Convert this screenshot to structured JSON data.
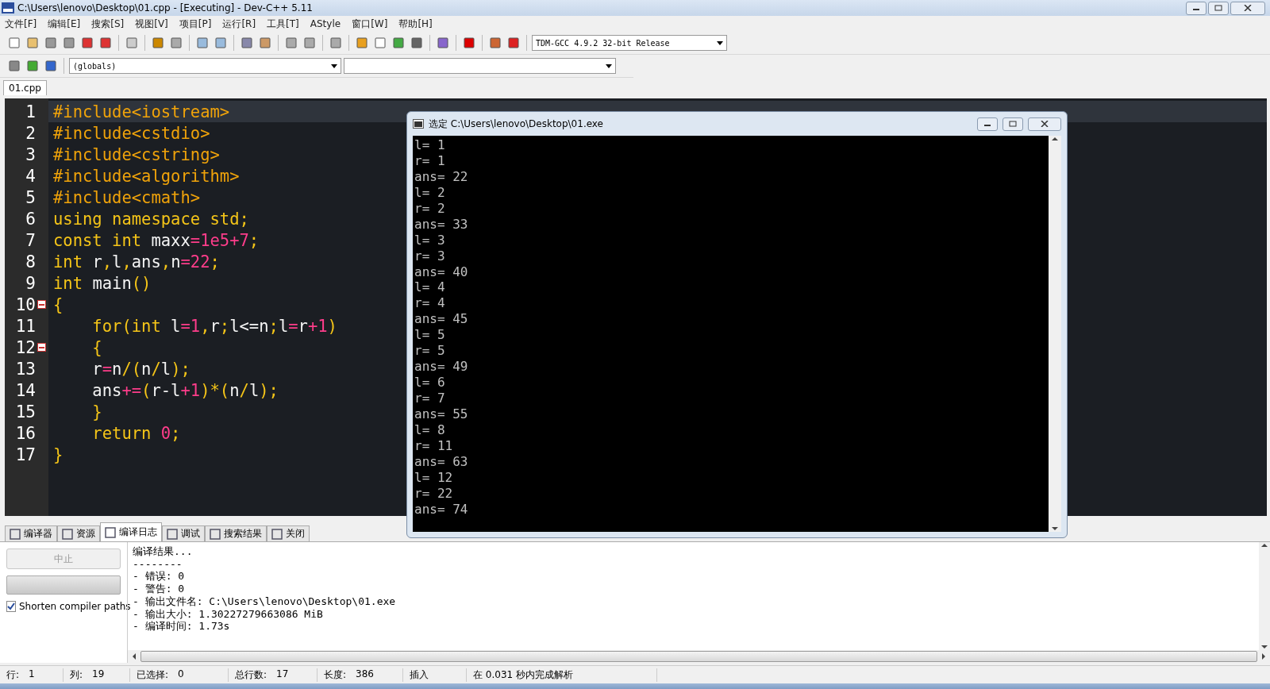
{
  "window": {
    "title": "C:\\Users\\lenovo\\Desktop\\01.cpp - [Executing] - Dev-C++ 5.11"
  },
  "menu": [
    "文件[F]",
    "编辑[E]",
    "搜索[S]",
    "视图[V]",
    "项目[P]",
    "运行[R]",
    "工具[T]",
    "AStyle",
    "窗口[W]",
    "帮助[H]"
  ],
  "compiler_select": {
    "value": "TDM-GCC 4.9.2 32-bit Release"
  },
  "class_select": {
    "value": "(globals)"
  },
  "file_tabs": [
    {
      "label": "01.cpp",
      "selected": true
    }
  ],
  "editor": {
    "lines": [
      {
        "number": "1",
        "fold": false,
        "current": true,
        "tokens": [
          {
            "kind": "pre",
            "text": "#include<iostream>"
          }
        ]
      },
      {
        "number": "2",
        "fold": false,
        "current": false,
        "tokens": [
          {
            "kind": "pre",
            "text": "#include<cstdio>"
          }
        ]
      },
      {
        "number": "3",
        "fold": false,
        "current": false,
        "tokens": [
          {
            "kind": "pre",
            "text": "#include<cstring>"
          }
        ]
      },
      {
        "number": "4",
        "fold": false,
        "current": false,
        "tokens": [
          {
            "kind": "pre",
            "text": "#include<algorithm>"
          }
        ]
      },
      {
        "number": "5",
        "fold": false,
        "current": false,
        "tokens": [
          {
            "kind": "pre",
            "text": "#include<cmath>"
          }
        ]
      },
      {
        "number": "6",
        "fold": false,
        "current": false,
        "tokens": [
          {
            "kind": "kw",
            "text": "using namespace std;"
          }
        ]
      },
      {
        "number": "7",
        "fold": false,
        "current": false,
        "tokens": [
          {
            "kind": "kw",
            "text": "const int "
          },
          {
            "kind": "id",
            "text": "maxx"
          },
          {
            "kind": "num",
            "text": "=1e5+7"
          },
          {
            "kind": "kw",
            "text": ";"
          }
        ]
      },
      {
        "number": "8",
        "fold": false,
        "current": false,
        "tokens": [
          {
            "kind": "kw",
            "text": "int "
          },
          {
            "kind": "id",
            "text": "r"
          },
          {
            "kind": "kw",
            "text": ","
          },
          {
            "kind": "id",
            "text": "l"
          },
          {
            "kind": "kw",
            "text": ","
          },
          {
            "kind": "id",
            "text": "ans"
          },
          {
            "kind": "kw",
            "text": ","
          },
          {
            "kind": "id",
            "text": "n"
          },
          {
            "kind": "num",
            "text": "=22"
          },
          {
            "kind": "kw",
            "text": ";"
          }
        ]
      },
      {
        "number": "9",
        "fold": false,
        "current": false,
        "tokens": [
          {
            "kind": "kw",
            "text": "int "
          },
          {
            "kind": "id",
            "text": "main"
          },
          {
            "kind": "kw",
            "text": "()"
          }
        ]
      },
      {
        "number": "10",
        "fold": true,
        "current": false,
        "tokens": [
          {
            "kind": "kw",
            "text": "{"
          }
        ]
      },
      {
        "number": "11",
        "fold": false,
        "current": false,
        "tokens": [
          {
            "kind": "kw",
            "text": "    for(int "
          },
          {
            "kind": "id",
            "text": "l"
          },
          {
            "kind": "num",
            "text": "=1"
          },
          {
            "kind": "kw",
            "text": ","
          },
          {
            "kind": "id",
            "text": "r"
          },
          {
            "kind": "kw",
            "text": ";"
          },
          {
            "kind": "id",
            "text": "l<=n"
          },
          {
            "kind": "kw",
            "text": ";"
          },
          {
            "kind": "id",
            "text": "l"
          },
          {
            "kind": "num",
            "text": "="
          },
          {
            "kind": "id",
            "text": "r"
          },
          {
            "kind": "num",
            "text": "+1"
          },
          {
            "kind": "kw",
            "text": ")"
          }
        ]
      },
      {
        "number": "12",
        "fold": true,
        "current": false,
        "tokens": [
          {
            "kind": "kw",
            "text": "    {"
          }
        ]
      },
      {
        "number": "13",
        "fold": false,
        "current": false,
        "tokens": [
          {
            "kind": "id",
            "text": "    r"
          },
          {
            "kind": "num",
            "text": "="
          },
          {
            "kind": "id",
            "text": "n"
          },
          {
            "kind": "kw",
            "text": "/("
          },
          {
            "kind": "id",
            "text": "n"
          },
          {
            "kind": "kw",
            "text": "/"
          },
          {
            "kind": "id",
            "text": "l"
          },
          {
            "kind": "kw",
            "text": ");"
          }
        ]
      },
      {
        "number": "14",
        "fold": false,
        "current": false,
        "tokens": [
          {
            "kind": "id",
            "text": "    ans"
          },
          {
            "kind": "num",
            "text": "+="
          },
          {
            "kind": "kw",
            "text": "("
          },
          {
            "kind": "id",
            "text": "r-l"
          },
          {
            "kind": "num",
            "text": "+1"
          },
          {
            "kind": "kw",
            "text": ")*("
          },
          {
            "kind": "id",
            "text": "n"
          },
          {
            "kind": "kw",
            "text": "/"
          },
          {
            "kind": "id",
            "text": "l"
          },
          {
            "kind": "kw",
            "text": ");"
          }
        ]
      },
      {
        "number": "15",
        "fold": false,
        "current": false,
        "tokens": [
          {
            "kind": "kw",
            "text": "    }"
          }
        ]
      },
      {
        "number": "16",
        "fold": false,
        "current": false,
        "tokens": [
          {
            "kind": "kw",
            "text": "    return "
          },
          {
            "kind": "num",
            "text": "0"
          },
          {
            "kind": "kw",
            "text": ";"
          }
        ]
      },
      {
        "number": "17",
        "fold": false,
        "current": false,
        "tokens": [
          {
            "kind": "kw",
            "text": "}"
          }
        ]
      }
    ]
  },
  "console": {
    "title": "选定 C:\\Users\\lenovo\\Desktop\\01.exe",
    "lines": [
      "l= 1",
      "r= 1",
      "ans= 22",
      "l= 2",
      "r= 2",
      "ans= 33",
      "l= 3",
      "r= 3",
      "ans= 40",
      "l= 4",
      "r= 4",
      "ans= 45",
      "l= 5",
      "r= 5",
      "ans= 49",
      "l= 6",
      "r= 7",
      "ans= 55",
      "l= 8",
      "r= 11",
      "ans= 63",
      "l= 12",
      "r= 22",
      "ans= 74"
    ]
  },
  "bottom_tabs": [
    {
      "label": "编译器",
      "selected": false
    },
    {
      "label": "资源",
      "selected": false
    },
    {
      "label": "编译日志",
      "selected": true
    },
    {
      "label": "调试",
      "selected": false
    },
    {
      "label": "搜索结果",
      "selected": false
    },
    {
      "label": "关闭",
      "selected": false
    }
  ],
  "abort_button": {
    "label": "中止",
    "disabled": true
  },
  "progress": {
    "level": 0
  },
  "shorten_paths": {
    "label": "Shorten compiler paths",
    "checked": true
  },
  "log": [
    "编译结果...",
    "--------",
    "- 错误: 0",
    "- 警告: 0",
    "- 输出文件名: C:\\Users\\lenovo\\Desktop\\01.exe",
    "- 输出大小: 1.30227279663086 MiB",
    "- 编译时间: 1.73s"
  ],
  "status_bar": [
    {
      "label": "行:",
      "value": "1"
    },
    {
      "label": "列:",
      "value": "19"
    },
    {
      "label": "已选择:",
      "value": "0"
    },
    {
      "label": "总行数:",
      "value": "17"
    },
    {
      "label": "长度:",
      "value": "386"
    },
    {
      "value": "插入"
    },
    {
      "value": "在 0.031 秒内完成解析"
    }
  ]
}
